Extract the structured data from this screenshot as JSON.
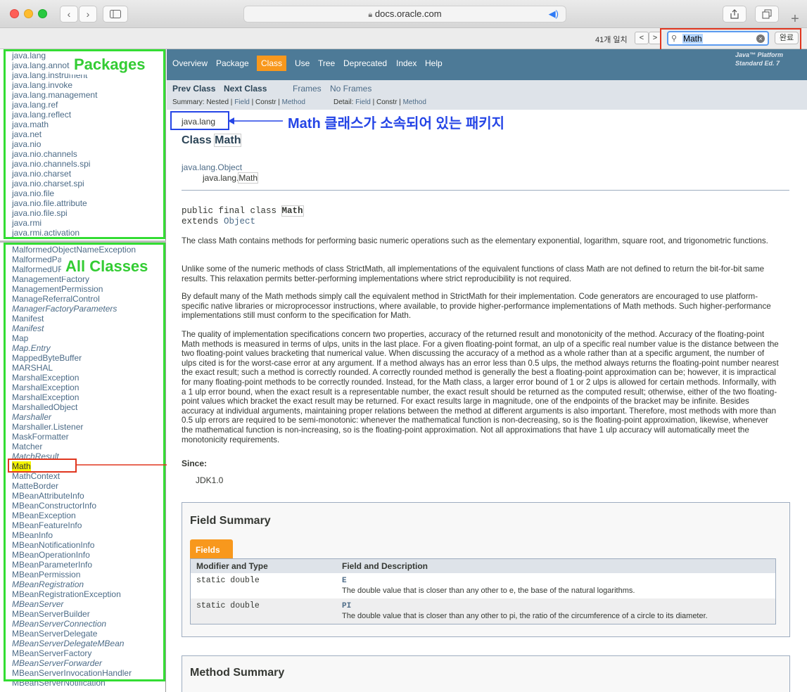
{
  "browser": {
    "url": "docs.oracle.com",
    "find": {
      "match_count": "41개 일치",
      "query": "Math",
      "done_label": "완료",
      "prev": "<",
      "next": ">"
    },
    "plus": "+"
  },
  "packages": [
    "java.lang",
    "java.lang.annot",
    "java.lang.instrument",
    "java.lang.invoke",
    "java.lang.management",
    "java.lang.ref",
    "java.lang.reflect",
    "java.math",
    "java.net",
    "java.nio",
    "java.nio.channels",
    "java.nio.channels.spi",
    "java.nio.charset",
    "java.nio.charset.spi",
    "java.nio.file",
    "java.nio.file.attribute",
    "java.nio.file.spi",
    "java.rmi",
    "java.rmi.activation"
  ],
  "classes": [
    "MalformedObjectNameException",
    "MalformedPa",
    "MalformedUR",
    "ManagementFactory",
    "ManagementPermission",
    "ManageReferralControl",
    "ManagerFactoryParameters",
    "Manifest",
    "Manifest",
    "Map",
    "Map.Entry",
    "MappedByteBuffer",
    "MARSHAL",
    "MarshalException",
    "MarshalException",
    "MarshalException",
    "MarshalledObject",
    "Marshaller",
    "Marshaller.Listener",
    "MaskFormatter",
    "Matcher",
    "MatchResult",
    "Math",
    "MathContext",
    "MatteBorder",
    "MBeanAttributeInfo",
    "MBeanConstructorInfo",
    "MBeanException",
    "MBeanFeatureInfo",
    "MBeanInfo",
    "MBeanNotificationInfo",
    "MBeanOperationInfo",
    "MBeanParameterInfo",
    "MBeanPermission",
    "MBeanRegistration",
    "MBeanRegistrationException",
    "MBeanServer",
    "MBeanServerBuilder",
    "MBeanServerConnection",
    "MBeanServerDelegate",
    "MBeanServerDelegateMBean",
    "MBeanServerFactory",
    "MBeanServerForwarder",
    "MBeanServerInvocationHandler",
    "MBeanServerNotification"
  ],
  "italic_classes": [
    6,
    8,
    10,
    17,
    21,
    34,
    36,
    38,
    40,
    42
  ],
  "annotations": {
    "packages": "Packages",
    "all_classes": "All Classes",
    "math_pkg": "Math 클래스가 소속되어 있는 패키지"
  },
  "nav": {
    "items": [
      "Overview",
      "Package",
      "Class",
      "Use",
      "Tree",
      "Deprecated",
      "Index",
      "Help"
    ],
    "platform_1": "Java™ Platform",
    "platform_2": "Standard Ed. 7"
  },
  "subnav": {
    "prev": "Prev Class",
    "next": "Next Class",
    "frames": "Frames",
    "noframes": "No Frames",
    "summary_label": "Summary: Nested | ",
    "summary_field": "Field",
    "sep1": " | Constr | ",
    "summary_method": "Method",
    "detail_label": "Detail: ",
    "detail_field": "Field",
    "sep2": " | Constr | ",
    "detail_method": "Method"
  },
  "doc": {
    "package": "java.lang",
    "class_word": "Class ",
    "class_name": "Math",
    "hier_parent": "java.lang.Object",
    "hier_child_prefix": "java.lang.",
    "decl_1": "public final class ",
    "decl_extends": "extends ",
    "decl_object": "Object",
    "p1": "The class Math contains methods for performing basic numeric operations such as the elementary exponential, logarithm, square root, and trigonometric functions.",
    "p2": "Unlike some of the numeric methods of class StrictMath, all implementations of the equivalent functions of class Math are not defined to return the bit-for-bit same results. This relaxation permits better-performing implementations where strict reproducibility is not required.",
    "p3": "By default many of the Math methods simply call the equivalent method in StrictMath for their implementation. Code generators are encouraged to use platform-specific native libraries or microprocessor instructions, where available, to provide higher-performance implementations of Math methods. Such higher-performance implementations still must conform to the specification for Math.",
    "p4": "The quality of implementation specifications concern two properties, accuracy of the returned result and monotonicity of the method. Accuracy of the floating-point Math methods is measured in terms of ulps, units in the last place. For a given floating-point format, an ulp of a specific real number value is the distance between the two floating-point values bracketing that numerical value. When discussing the accuracy of a method as a whole rather than at a specific argument, the number of ulps cited is for the worst-case error at any argument. If a method always has an error less than 0.5 ulps, the method always returns the floating-point number nearest the exact result; such a method is correctly rounded. A correctly rounded method is generally the best a floating-point approximation can be; however, it is impractical for many floating-point methods to be correctly rounded. Instead, for the Math class, a larger error bound of 1 or 2 ulps is allowed for certain methods. Informally, with a 1 ulp error bound, when the exact result is a representable number, the exact result should be returned as the computed result; otherwise, either of the two floating-point values which bracket the exact result may be returned. For exact results large in magnitude, one of the endpoints of the bracket may be infinite. Besides accuracy at individual arguments, maintaining proper relations between the method at different arguments is also important. Therefore, most methods with more than 0.5 ulp errors are required to be semi-monotonic: whenever the mathematical function is non-decreasing, so is the floating-point approximation, likewise, whenever the mathematical function is non-increasing, so is the floating-point approximation. Not all approximations that have 1 ulp accuracy will automatically meet the monotonicity requirements.",
    "since_label": "Since:",
    "since_value": "JDK1.0",
    "field_summary": "Field Summary",
    "fields_tab": "Fields",
    "col1": "Modifier and Type",
    "col2": "Field and Description",
    "rows": [
      {
        "type": "static double",
        "name": "E",
        "desc": "The double value that is closer than any other to e, the base of the natural logarithms."
      },
      {
        "type": "static double",
        "name": "PI",
        "desc": "The double value that is closer than any other to pi, the ratio of the circumference of a circle to its diameter."
      }
    ],
    "method_summary": "Method Summary"
  }
}
